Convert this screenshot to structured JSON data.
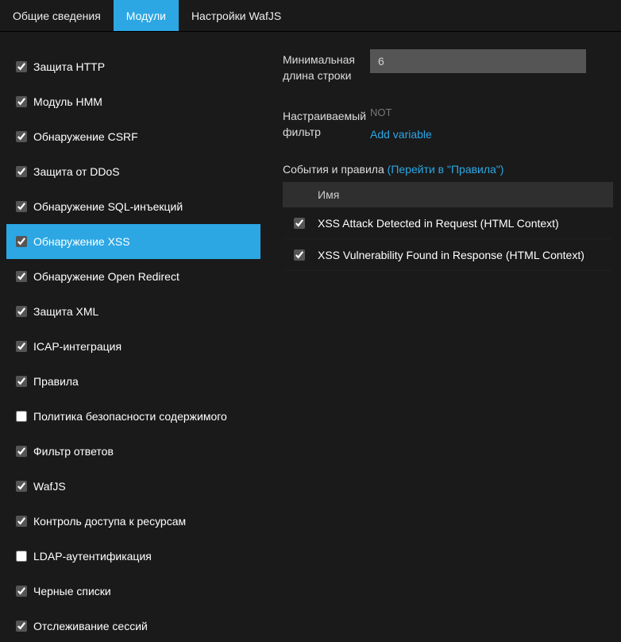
{
  "tabs": [
    {
      "label": "Общие сведения",
      "active": false
    },
    {
      "label": "Модули",
      "active": true
    },
    {
      "label": "Настройки WafJS",
      "active": false
    }
  ],
  "modules": [
    {
      "label": "Защита HTTP",
      "checked": true,
      "selected": false
    },
    {
      "label": "Модуль HMM",
      "checked": true,
      "selected": false
    },
    {
      "label": "Обнаружение CSRF",
      "checked": true,
      "selected": false
    },
    {
      "label": "Защита от DDoS",
      "checked": true,
      "selected": false
    },
    {
      "label": "Обнаружение SQL-инъекций",
      "checked": true,
      "selected": false
    },
    {
      "label": "Обнаружение XSS",
      "checked": true,
      "selected": true
    },
    {
      "label": "Обнаружение Open Redirect",
      "checked": true,
      "selected": false
    },
    {
      "label": "Защита XML",
      "checked": true,
      "selected": false
    },
    {
      "label": "ICAP-интеграция",
      "checked": true,
      "selected": false
    },
    {
      "label": "Правила",
      "checked": true,
      "selected": false
    },
    {
      "label": "Политика безопасности содержимого",
      "checked": false,
      "selected": false
    },
    {
      "label": "Фильтр ответов",
      "checked": true,
      "selected": false
    },
    {
      "label": "WafJS",
      "checked": true,
      "selected": false
    },
    {
      "label": "Контроль доступа к ресурсам",
      "checked": true,
      "selected": false
    },
    {
      "label": "LDAP-аутентификация",
      "checked": false,
      "selected": false
    },
    {
      "label": "Черные списки",
      "checked": true,
      "selected": false
    },
    {
      "label": "Отслеживание сессий",
      "checked": true,
      "selected": false
    }
  ],
  "settings": {
    "min_len_label": "Минимальная длина строки",
    "min_len_value": "6",
    "filter_label": "Настраиваемый фильтр",
    "filter_not": "NOT",
    "add_variable": "Add variable"
  },
  "events": {
    "title": "События и правила",
    "link": "(Перейти в \"Правила\")",
    "column_name": "Имя",
    "rows": [
      {
        "label": "XSS Attack Detected in Request (HTML Context)",
        "checked": true
      },
      {
        "label": "XSS Vulnerability Found in Response (HTML Context)",
        "checked": true
      }
    ]
  }
}
